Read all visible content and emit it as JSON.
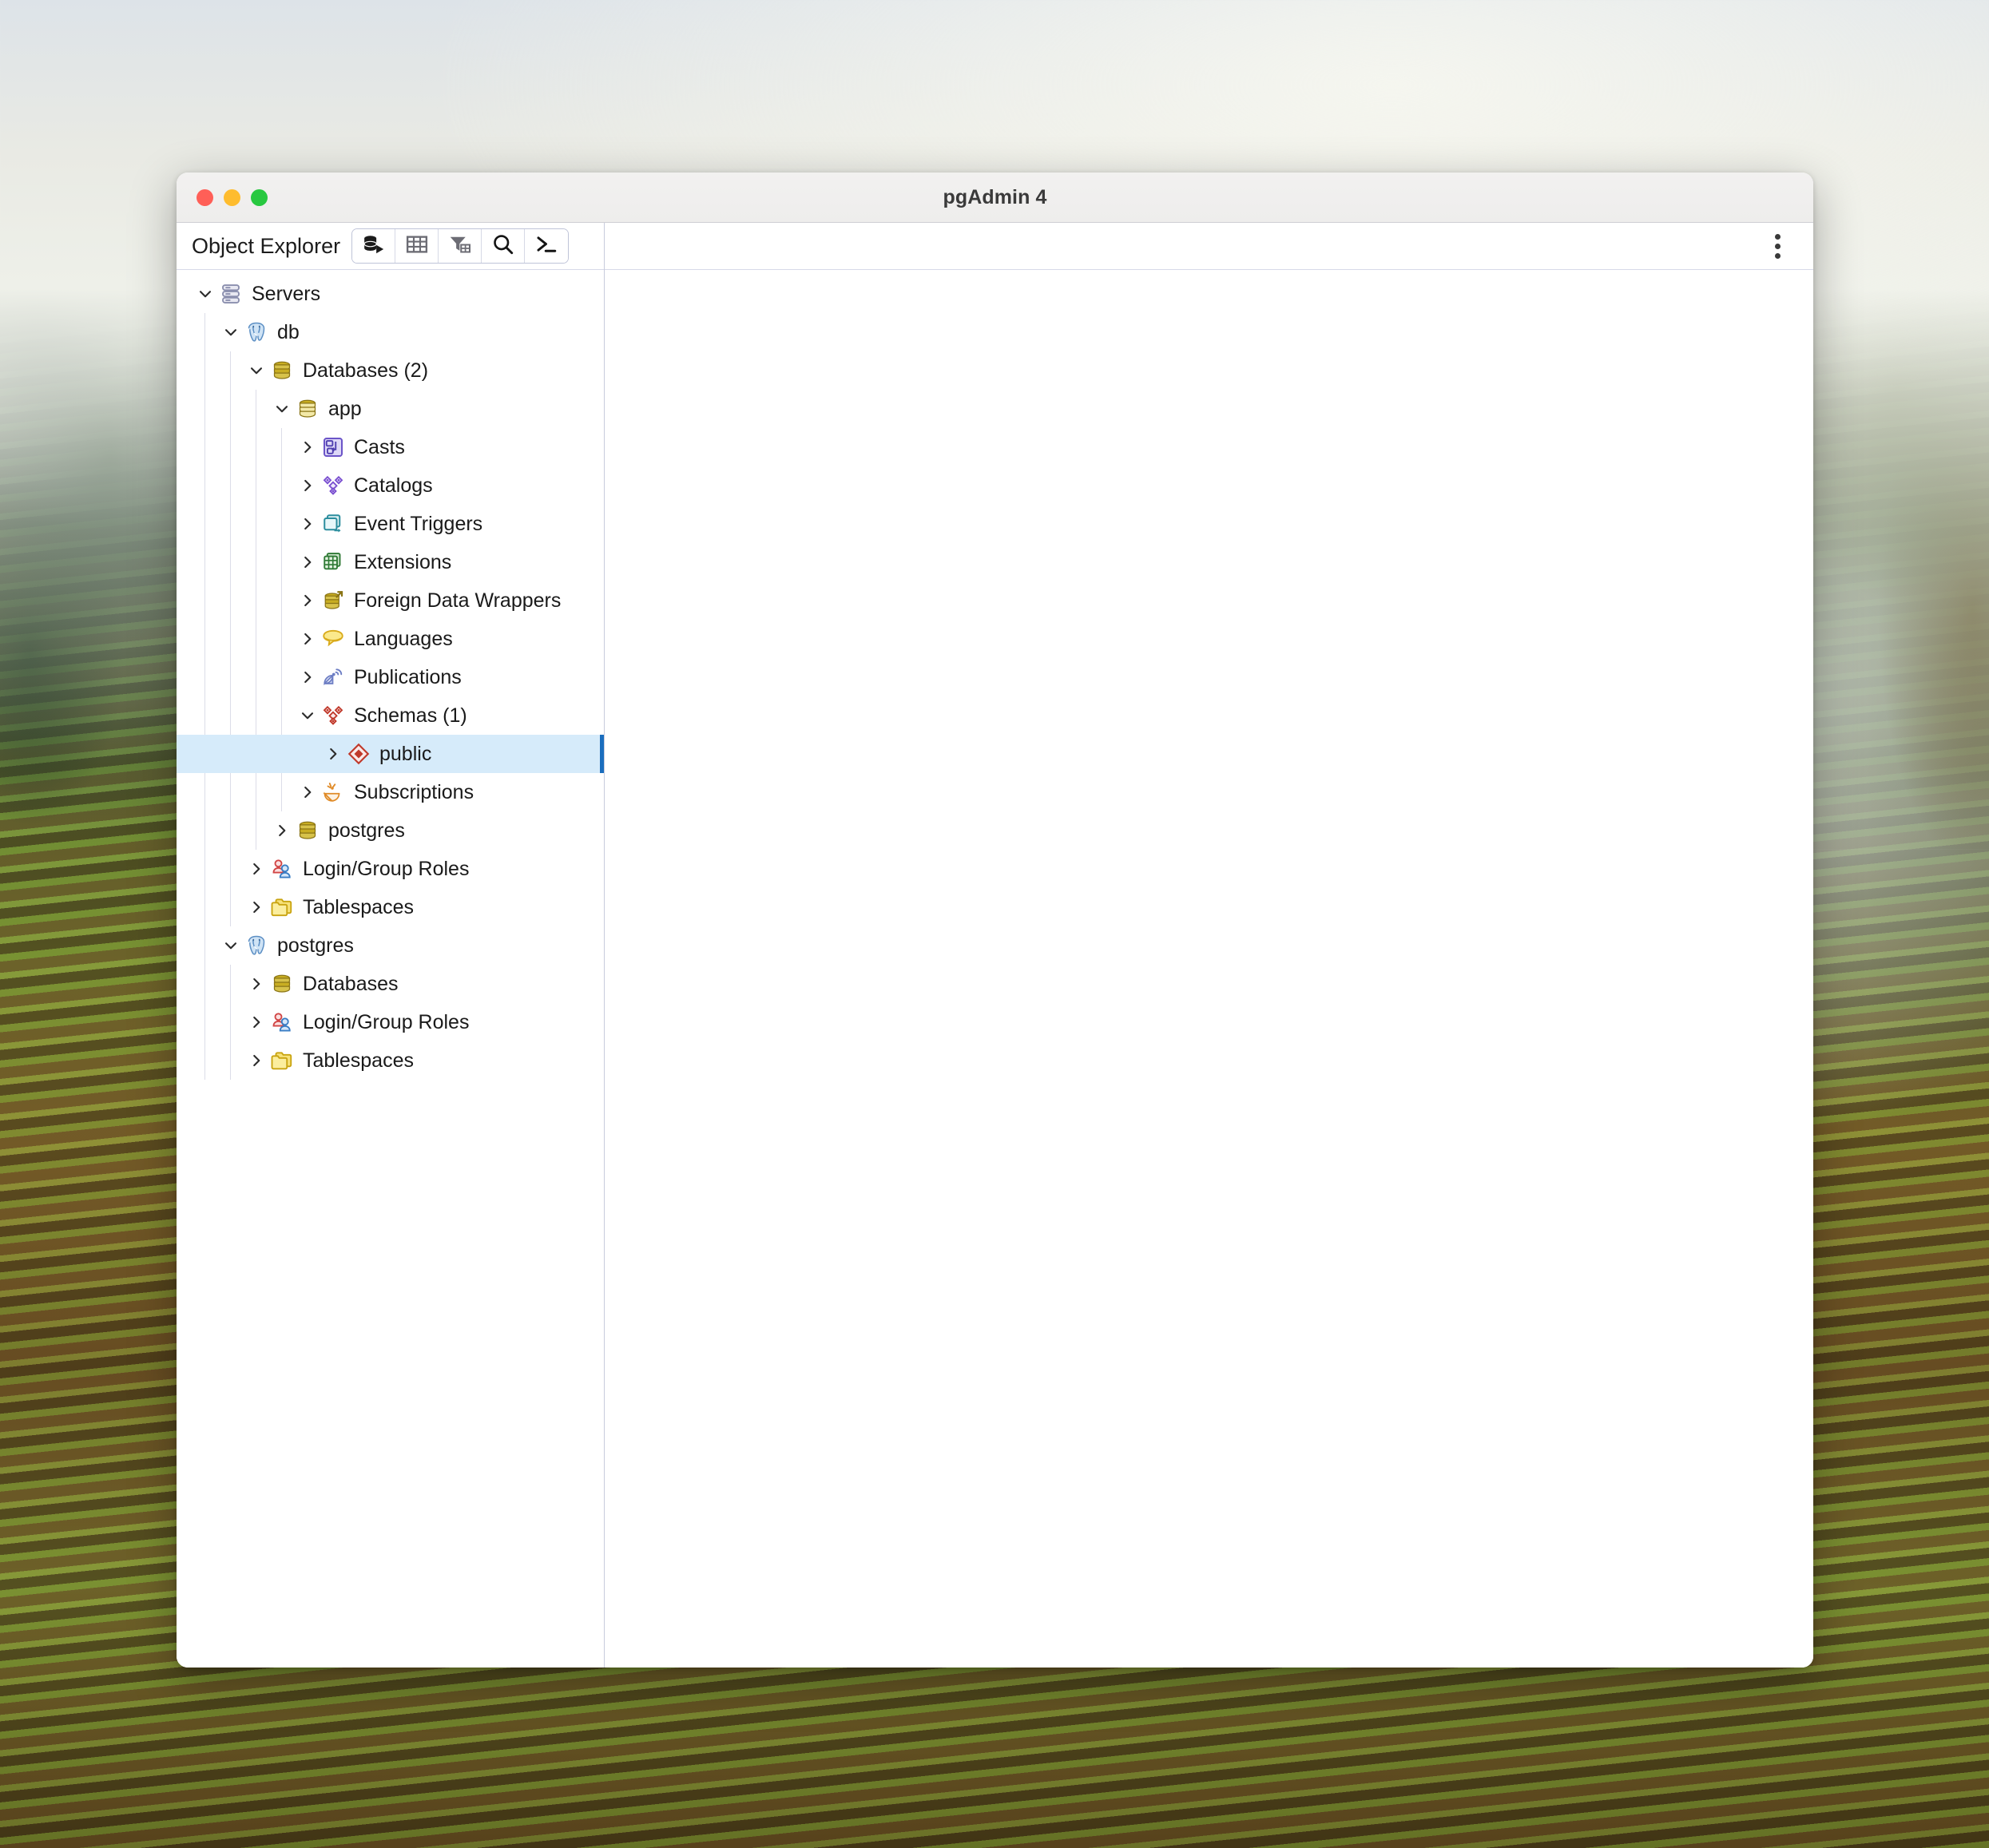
{
  "window": {
    "title": "pgAdmin 4",
    "traffic_lights": [
      {
        "name": "close-button",
        "color": "#ff5f57"
      },
      {
        "name": "minimize-button",
        "color": "#febc2e"
      },
      {
        "name": "maximize-button",
        "color": "#28c840"
      }
    ]
  },
  "object_explorer": {
    "title": "Object Explorer",
    "toolbar": [
      {
        "icon": "database-connect-icon",
        "label": "Add New Server"
      },
      {
        "icon": "table-grid-icon",
        "label": "View Data"
      },
      {
        "icon": "filter-table-icon",
        "label": "Filtered Rows"
      },
      {
        "icon": "search-icon",
        "label": "Search Objects"
      },
      {
        "icon": "terminal-icon",
        "label": "PSQL Tool"
      }
    ]
  },
  "main_panel": {
    "menu_icon": "kebab-menu-icon"
  },
  "tree": {
    "nodes": [
      {
        "label": "Servers",
        "depth": 0,
        "twisty": "down",
        "icon": "servers-icon",
        "selected": false
      },
      {
        "label": "db",
        "depth": 1,
        "twisty": "down",
        "icon": "postgres-icon",
        "selected": false
      },
      {
        "label": "Databases (2)",
        "depth": 2,
        "twisty": "down",
        "icon": "databases-icon",
        "selected": false
      },
      {
        "label": "app",
        "depth": 3,
        "twisty": "down",
        "icon": "database-open-icon",
        "selected": false
      },
      {
        "label": "Casts",
        "depth": 4,
        "twisty": "right",
        "icon": "casts-icon",
        "selected": false
      },
      {
        "label": "Catalogs",
        "depth": 4,
        "twisty": "right",
        "icon": "catalogs-icon",
        "selected": false
      },
      {
        "label": "Event Triggers",
        "depth": 4,
        "twisty": "right",
        "icon": "event-triggers-icon",
        "selected": false
      },
      {
        "label": "Extensions",
        "depth": 4,
        "twisty": "right",
        "icon": "extensions-icon",
        "selected": false
      },
      {
        "label": "Foreign Data Wrappers",
        "depth": 4,
        "twisty": "right",
        "icon": "foreign-data-wrappers-icon",
        "selected": false
      },
      {
        "label": "Languages",
        "depth": 4,
        "twisty": "right",
        "icon": "languages-icon",
        "selected": false
      },
      {
        "label": "Publications",
        "depth": 4,
        "twisty": "right",
        "icon": "publications-icon",
        "selected": false
      },
      {
        "label": "Schemas (1)",
        "depth": 4,
        "twisty": "down",
        "icon": "schemas-icon",
        "selected": false
      },
      {
        "label": "public",
        "depth": 5,
        "twisty": "right",
        "icon": "schema-icon",
        "selected": true
      },
      {
        "label": "Subscriptions",
        "depth": 4,
        "twisty": "right",
        "icon": "subscriptions-icon",
        "selected": false
      },
      {
        "label": "postgres",
        "depth": 3,
        "twisty": "right",
        "icon": "databases-icon",
        "selected": false
      },
      {
        "label": "Login/Group Roles",
        "depth": 2,
        "twisty": "right",
        "icon": "roles-icon",
        "selected": false
      },
      {
        "label": "Tablespaces",
        "depth": 2,
        "twisty": "right",
        "icon": "tablespaces-icon",
        "selected": false
      },
      {
        "label": "postgres",
        "depth": 1,
        "twisty": "down",
        "icon": "postgres-icon",
        "selected": false
      },
      {
        "label": "Databases",
        "depth": 2,
        "twisty": "right",
        "icon": "databases-icon",
        "selected": false
      },
      {
        "label": "Login/Group Roles",
        "depth": 2,
        "twisty": "right",
        "icon": "roles-icon",
        "selected": false
      },
      {
        "label": "Tablespaces",
        "depth": 2,
        "twisty": "right",
        "icon": "tablespaces-icon",
        "selected": false
      }
    ]
  },
  "colors": {
    "selection_bg": "#d6ebfa",
    "selection_marker": "#1a6dbd",
    "panel_border": "#c8cbdc",
    "titlebar_bg": "#f1f0ef"
  }
}
